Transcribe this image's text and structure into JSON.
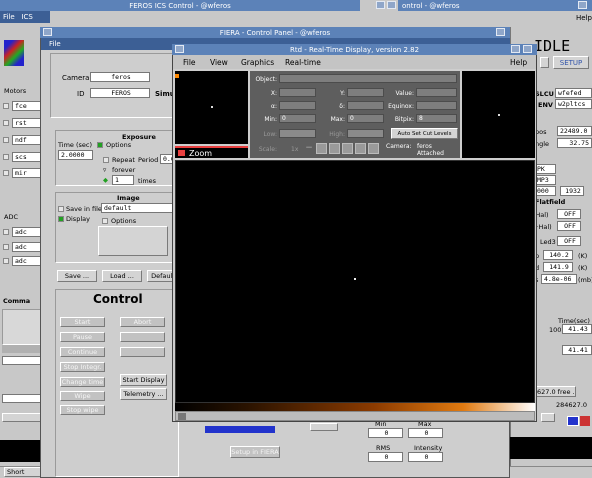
{
  "top_bar": {
    "ics_title": "FEROS ICS Control - @wferos",
    "control_title": "ontrol - @wferos",
    "help": "Help"
  },
  "ics_win": {
    "menu_file": "File",
    "menu_ics": "ICS",
    "motors_label": "Motors",
    "motor_items": [
      "fce",
      "rst",
      "ndf",
      "scs",
      "mir"
    ],
    "adc_label": "ADC",
    "adc_items": [
      "adc",
      "adc",
      "adc"
    ],
    "command_label": "Comma",
    "short_label": "Short"
  },
  "fiera": {
    "title": "FIERA - Control Panel - @wferos",
    "menu_file": "File",
    "camera_label": "Camera",
    "camera_value": "feros",
    "id_label": "ID",
    "id_value": "FEROS",
    "simu_label": "Simu",
    "exposure_title": "Exposure",
    "time_label": "Time (sec)",
    "time_value": "2.0000",
    "options": "Options",
    "repeat": "Repeat",
    "period": "Period",
    "period_value": "0.0",
    "forever": "forever",
    "times_value": "1",
    "times": "times",
    "image_title": "Image",
    "save_in_file": "Save in file",
    "save_file_value": "default",
    "display": "Display",
    "image_options": "Options",
    "save_btn": "Save ...",
    "load_btn": "Load ...",
    "default_btn": "Default",
    "control_title": "Control",
    "ctrl_buttons": [
      "Start",
      "Abort",
      "Pause",
      "Continue",
      "Stop Integr.",
      "Change time",
      "Wipe",
      "Stop wipe",
      "Start Display",
      "Telemetry ..."
    ],
    "setup_in_fiera": "Setup in FIERA",
    "stats_min": "Min",
    "stats_max": "Max",
    "stats_min_value": "0",
    "stats_max_value": "0",
    "rms": "RMS",
    "intensity": "Intensity",
    "rms_value": "0",
    "intensity_value": "0"
  },
  "right_panel": {
    "title": "IDLE",
    "setup_btn": "SETUP",
    "slcu_label": "SLCU",
    "slcu_value": "wfefed",
    "env_label": "ENV",
    "env_value": "w2pltcs",
    "pos_label": "pos",
    "pos_value": "22489.0",
    "angle_label": "ngle",
    "angle_value": "32.75",
    "fld1": "PK",
    "fld2": "MP3",
    "fld3": "000",
    "fld3b": "1932",
    "flatfield": "Flatfield",
    "ff_row1": "-Hal)",
    "ff_row1_val": "OFF",
    "ff_row2": "+Hal)",
    "ff_row2_val": "OFF",
    "led3": "Led3",
    "led3_val": "OFF",
    "p_label": "p",
    "p_value": "140.2",
    "p_unit": "(K)",
    "d_label": "d",
    "d_value": "141.9",
    "d_unit": "(K)",
    "s_label": "s",
    "s_value": "4.8e-06",
    "s_unit": "(mb)",
    "time_sec": "Time(sec)",
    "time_num": "100",
    "time_v1": "41.43",
    "time_v2": "41.41",
    "free_label": "627.0 free ...",
    "free_value": "284627.0"
  },
  "rtd": {
    "title": "Rtd - Real-Time Display, version 2.82",
    "menu": [
      "File",
      "View",
      "Graphics",
      "Real-time"
    ],
    "menu_help": "Help",
    "zoom": "Zoom",
    "object": "Object:",
    "x": "X:",
    "y": "Y:",
    "value": "Value:",
    "alpha": "α:",
    "delta": "δ:",
    "equinox": "Equinox:",
    "min": "Min:",
    "min_value": "0",
    "max": "Max:",
    "max_value": "0",
    "bitpix": "Bitpix:",
    "bitpix_value": "8",
    "low": "Low:",
    "high": "High:",
    "auto_set": "Auto Set Cut Levels",
    "scale": "Scale:",
    "scale_value": "1x",
    "camera_label": "Camera:",
    "camera_value": "feros",
    "camera_status": "Attached"
  }
}
